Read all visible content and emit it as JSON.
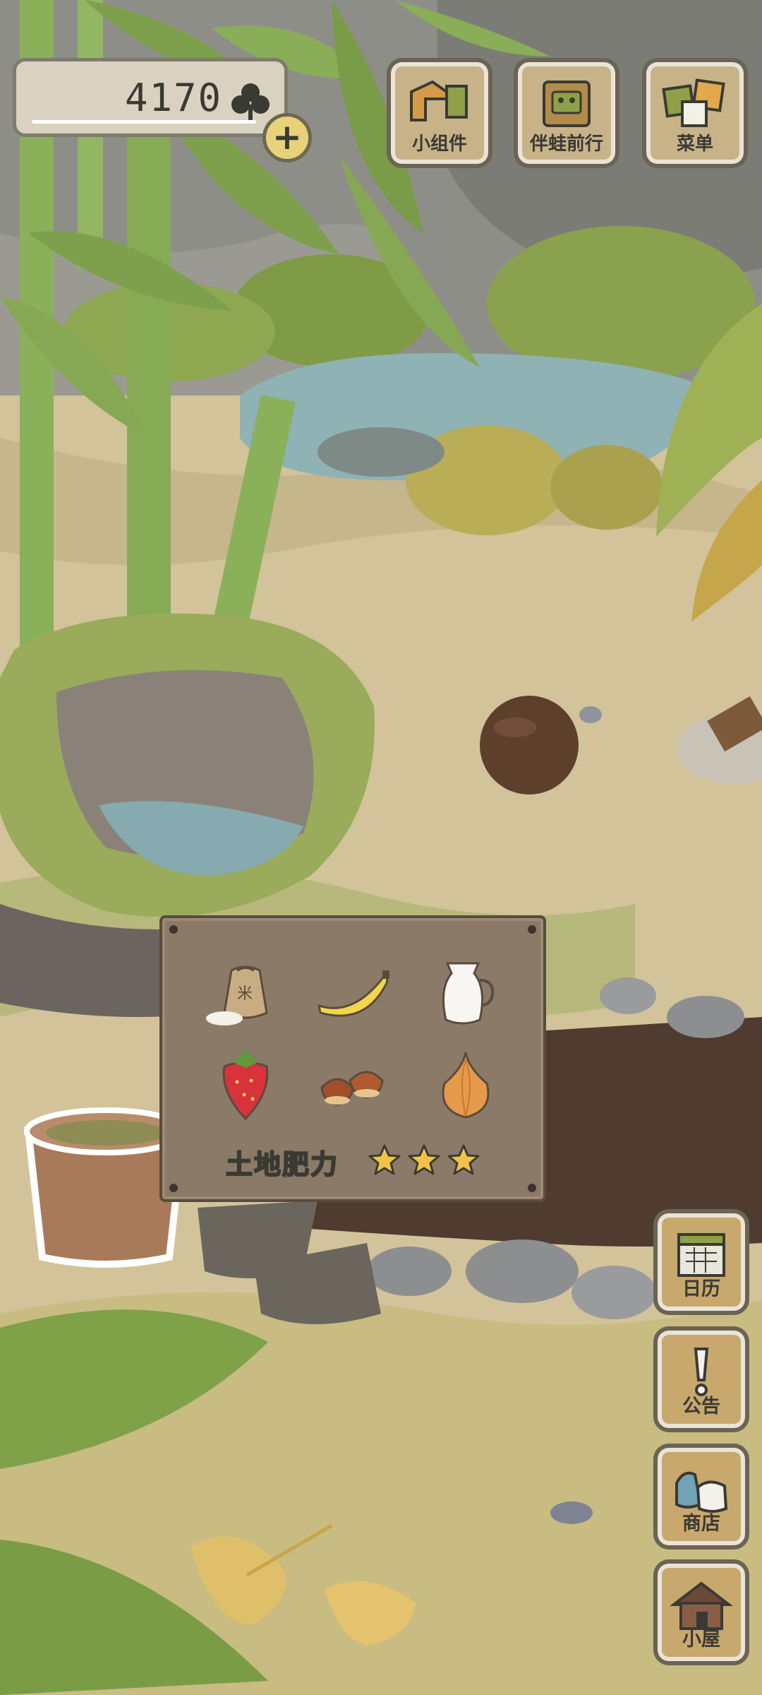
{
  "currency": {
    "amount": "4170",
    "icon": "clover-icon",
    "add_icon": "plus-icon"
  },
  "top_buttons": [
    {
      "label": "小组件",
      "icon": "widget-icon"
    },
    {
      "label": "伴蛙前行",
      "icon": "frog-travel-icon"
    },
    {
      "label": "菜单",
      "icon": "menu-icon"
    }
  ],
  "side_buttons": [
    {
      "label": "日历",
      "icon": "calendar-icon"
    },
    {
      "label": "公告",
      "icon": "exclamation-icon"
    },
    {
      "label": "商店",
      "icon": "shop-bags-icon"
    },
    {
      "label": "小屋",
      "icon": "house-icon"
    }
  ],
  "garden_panel": {
    "items": [
      "rice-sack-icon",
      "banana-icon",
      "milk-jug-icon",
      "strawberry-icon",
      "chestnut-icon",
      "onion-icon"
    ],
    "fertility_label": "土地肥力",
    "fertility_stars": 3,
    "fertility_max": 3
  },
  "colors": {
    "star": "#f0c24a",
    "panel": "#8b7a67",
    "button_border": "#6b6454"
  }
}
